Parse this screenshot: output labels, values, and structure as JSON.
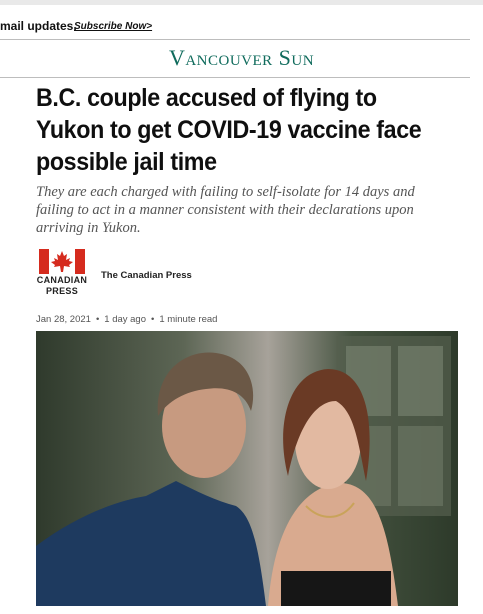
{
  "topbar": {
    "email_text": "mail updates.",
    "subscribe_label": "Subscribe Now>"
  },
  "masthead": {
    "title": "Vancouver Sun"
  },
  "article": {
    "headline": "B.C. couple accused of flying to Yukon to get COVID-19 vaccine face possible jail time",
    "deck": "They are each charged with failing to self-isolate for 14 days and failing to act in a manner consistent with their declarations upon arriving in Yukon.",
    "source_logo": {
      "line1": "CANADIAN",
      "line2": "PRESS",
      "icon": "maple-leaf-icon"
    },
    "byline": "The Canadian Press",
    "meta": {
      "date": "Jan 28, 2021",
      "age": "1 day ago",
      "read_time": "1 minute read"
    }
  },
  "colors": {
    "masthead": "#0f6b5c",
    "logo_red": "#d52b1e",
    "deck_text": "#555555"
  }
}
